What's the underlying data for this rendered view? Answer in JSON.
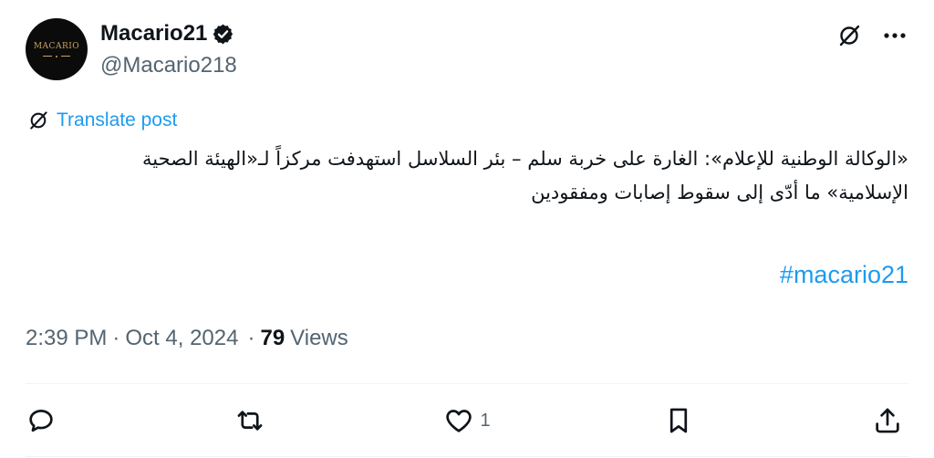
{
  "author": {
    "display_name": "Macario21",
    "handle": "@Macario218",
    "avatar_text": "MACARIO",
    "verified": true
  },
  "translate_label": "Translate post",
  "post": {
    "text": "«الوكالة الوطنية للإعلام»: الغارة على خربة سلم – بئر السلاسل استهدفت مركزاً لـ«الهيئة الصحية الإسلامية» ما أدّى إلى سقوط إصابات ومفقودين",
    "hashtag": "#macario21"
  },
  "meta": {
    "time": "2:39 PM",
    "separator": "·",
    "date": "Oct 4, 2024",
    "views_separator": "·",
    "views_count": "79",
    "views_label": "Views"
  },
  "actions": {
    "reply": {
      "icon": "reply-icon",
      "count": ""
    },
    "repost": {
      "icon": "repost-icon",
      "count": ""
    },
    "like": {
      "icon": "heart-icon",
      "count": "1"
    },
    "bookmark": {
      "icon": "bookmark-icon",
      "count": ""
    },
    "share": {
      "icon": "share-icon",
      "count": ""
    }
  },
  "colors": {
    "accent": "#1d9bf0",
    "text_primary": "#0f1419",
    "text_secondary": "#536471",
    "divider": "#eff3f4"
  }
}
